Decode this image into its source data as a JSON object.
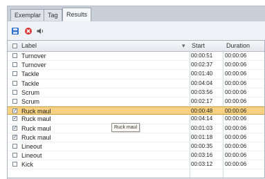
{
  "tabs": [
    {
      "label": "Exemplar",
      "active": false
    },
    {
      "label": "Tag",
      "active": false
    },
    {
      "label": "Results",
      "active": true
    }
  ],
  "toolbar": {
    "buttons": [
      {
        "icon": "save-icon",
        "color": "#2e6fd0"
      },
      {
        "icon": "cancel-icon",
        "color": "#d93434"
      },
      {
        "icon": "sound-icon",
        "color": "#555555"
      }
    ]
  },
  "table": {
    "columns": {
      "label": "Label",
      "start": "Start",
      "duration": "Duration"
    },
    "sort_indicator": "▾",
    "rows": [
      {
        "checked": false,
        "label": "Turnover",
        "start": "00:00:51",
        "duration": "00:00:06",
        "selected": false
      },
      {
        "checked": false,
        "label": "Turnover",
        "start": "00:02:37",
        "duration": "00:00:06",
        "selected": false
      },
      {
        "checked": false,
        "label": "Tackle",
        "start": "00:01:40",
        "duration": "00:00:06",
        "selected": false
      },
      {
        "checked": false,
        "label": "Tackle",
        "start": "00:04:04",
        "duration": "00:00:06",
        "selected": false
      },
      {
        "checked": false,
        "label": "Scrum",
        "start": "00:03:56",
        "duration": "00:00:06",
        "selected": false
      },
      {
        "checked": false,
        "label": "Scrum",
        "start": "00:02:17",
        "duration": "00:00:06",
        "selected": false
      },
      {
        "checked": true,
        "label": "Ruck maul",
        "start": "00:00:48",
        "duration": "00:00:06",
        "selected": true
      },
      {
        "checked": true,
        "label": "Ruck maul",
        "start": "00:04:14",
        "duration": "00:00:06",
        "selected": false
      },
      {
        "checked": true,
        "label": "Ruck maul",
        "start": "00:01:03",
        "duration": "00:00:06",
        "selected": false
      },
      {
        "checked": true,
        "label": "Ruck maul",
        "start": "00:01:18",
        "duration": "00:00:06",
        "selected": false
      },
      {
        "checked": false,
        "label": "Lineout",
        "start": "00:00:35",
        "duration": "00:00:06",
        "selected": false
      },
      {
        "checked": false,
        "label": "Lineout",
        "start": "00:03:16",
        "duration": "00:00:06",
        "selected": false
      },
      {
        "checked": false,
        "label": "Kick",
        "start": "00:03:12",
        "duration": "00:00:06",
        "selected": false
      }
    ]
  },
  "tooltip": {
    "text": "Ruck maul"
  },
  "colors": {
    "selected_row": "#f6d184",
    "frame": "#e3e7ed"
  }
}
